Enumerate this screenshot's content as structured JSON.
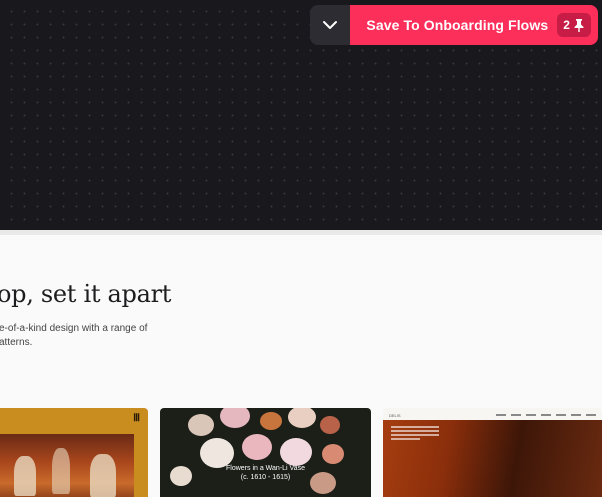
{
  "toolbar": {
    "collapse_icon": "chevron-down-icon",
    "save_label": "Save To Onboarding Flows",
    "save_count": "2",
    "pin_icon": "pin-icon",
    "accent_color": "#fc2e5a"
  },
  "content": {
    "heading": "op, set it apart",
    "description": "e-of-a-kind design with a range of atterns."
  },
  "cards": [
    {
      "name": "painting-card"
    },
    {
      "name": "flowers-card",
      "caption_title": "Flowers in a Wan-Li Vase",
      "caption_sub": "(c. 1610 - 1615)"
    },
    {
      "name": "portrait-card",
      "brand": "DELIS"
    }
  ]
}
